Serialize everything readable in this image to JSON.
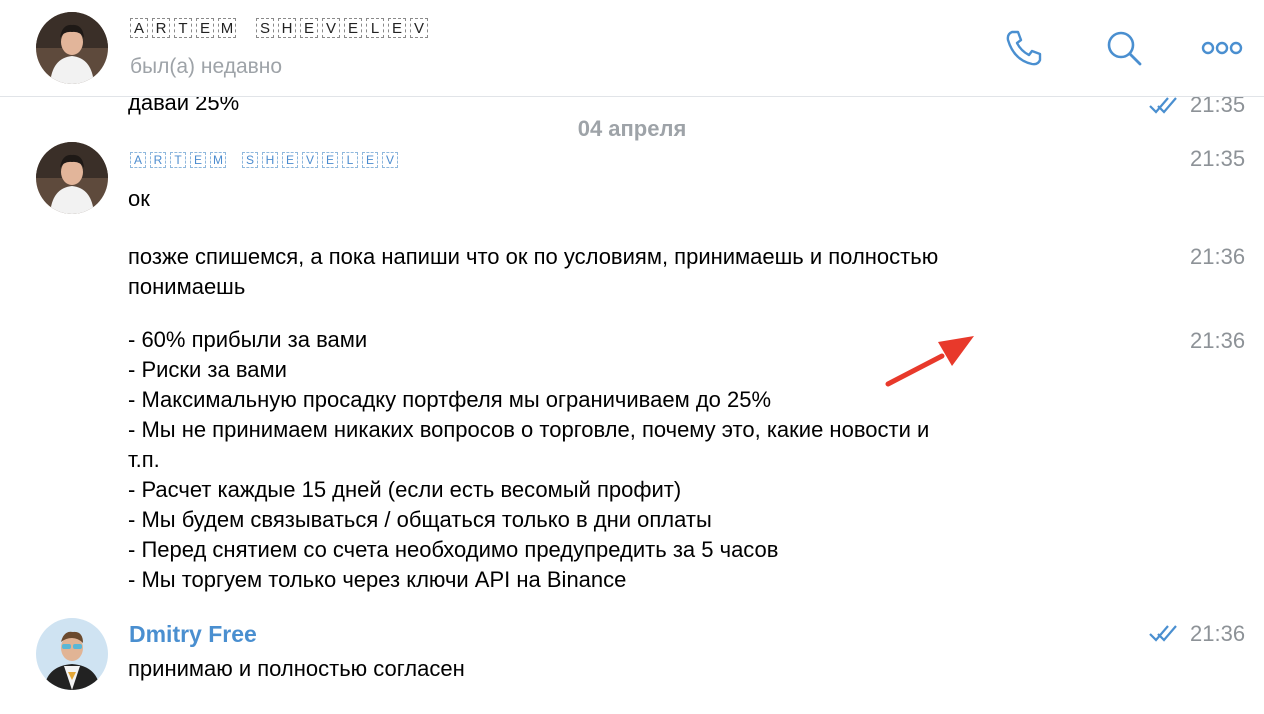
{
  "header": {
    "title_chars": [
      "A",
      "R",
      "T",
      "E",
      "M",
      " ",
      "S",
      "H",
      "E",
      "V",
      "E",
      "L",
      "E",
      "V"
    ],
    "status": "был(а) недавно",
    "icons": [
      "phone-icon",
      "search-icon",
      "more-icon"
    ]
  },
  "chat": {
    "prev_message": {
      "text": "давай 25%",
      "time": "21:35"
    },
    "date_separator": "04 апреля",
    "group1": {
      "sender_chars": [
        "A",
        "R",
        "T",
        "E",
        "M",
        " ",
        "S",
        "H",
        "E",
        "V",
        "E",
        "L",
        "E",
        "V"
      ],
      "messages": [
        {
          "text": "ок",
          "time": "21:35"
        },
        {
          "lines": [
            "позже спишемся, а пока напиши что ок по условиям, принимаешь и полностью",
            "понимаешь"
          ],
          "time": "21:36"
        },
        {
          "lines": [
            "- 60% прибыли за вами",
            "- Риски за вами",
            "- Максимальную просадку портфеля мы ограничиваем до 25%",
            "- Мы не принимаем никаких вопросов о торговле, почему это, какие новости и",
            "т.п.",
            "- Расчет каждые 15 дней (если есть весомый профит)",
            "- Мы будем связываться / общаться только в дни оплаты",
            "- Перед снятием со счета необходимо предупредить за 5 часов",
            "- Мы торгуем только через ключи API на Binance"
          ],
          "time": "21:36"
        }
      ]
    },
    "group2": {
      "sender": "Dmitry Free",
      "text": "принимаю и полностью согласен",
      "time": "21:36"
    }
  },
  "colors": {
    "accent": "#4a8fd0",
    "time": "#8d9297",
    "annotation_arrow": "#e8392b"
  }
}
